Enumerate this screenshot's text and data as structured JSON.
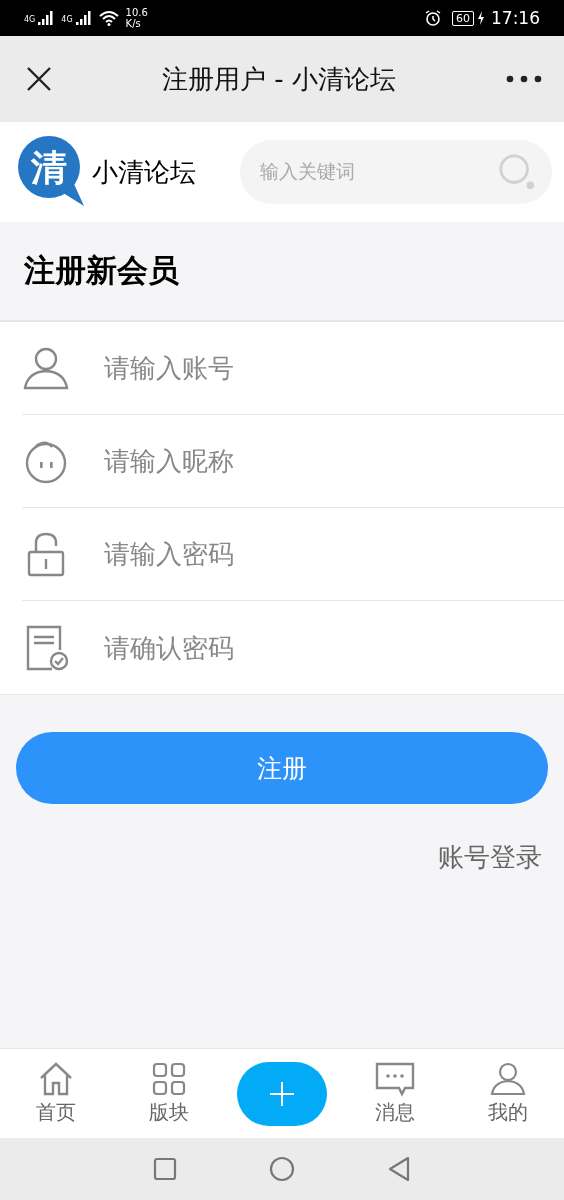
{
  "status_bar": {
    "signal_labels": [
      "4G",
      "4G"
    ],
    "speed_value": "10.6",
    "speed_unit": "K/s",
    "battery": "60",
    "time": "17:16"
  },
  "nav_bar": {
    "title": "注册用户 - 小清论坛"
  },
  "header": {
    "logo_glyph": "清",
    "site_name": "小清论坛",
    "search": {
      "placeholder": "输入关键词"
    }
  },
  "section_title": "注册新会员",
  "fields": [
    {
      "kind": "account",
      "placeholder": "请输入账号"
    },
    {
      "kind": "nickname",
      "placeholder": "请输入昵称"
    },
    {
      "kind": "password",
      "placeholder": "请输入密码"
    },
    {
      "kind": "confirm",
      "placeholder": "请确认密码"
    }
  ],
  "submit_button": "注册",
  "login_link": "账号登录",
  "tab_bar": [
    {
      "kind": "home",
      "label": "首页"
    },
    {
      "kind": "boards",
      "label": "版块"
    },
    {
      "kind": "post"
    },
    {
      "kind": "messages",
      "label": "消息"
    },
    {
      "kind": "profile",
      "label": "我的"
    }
  ]
}
